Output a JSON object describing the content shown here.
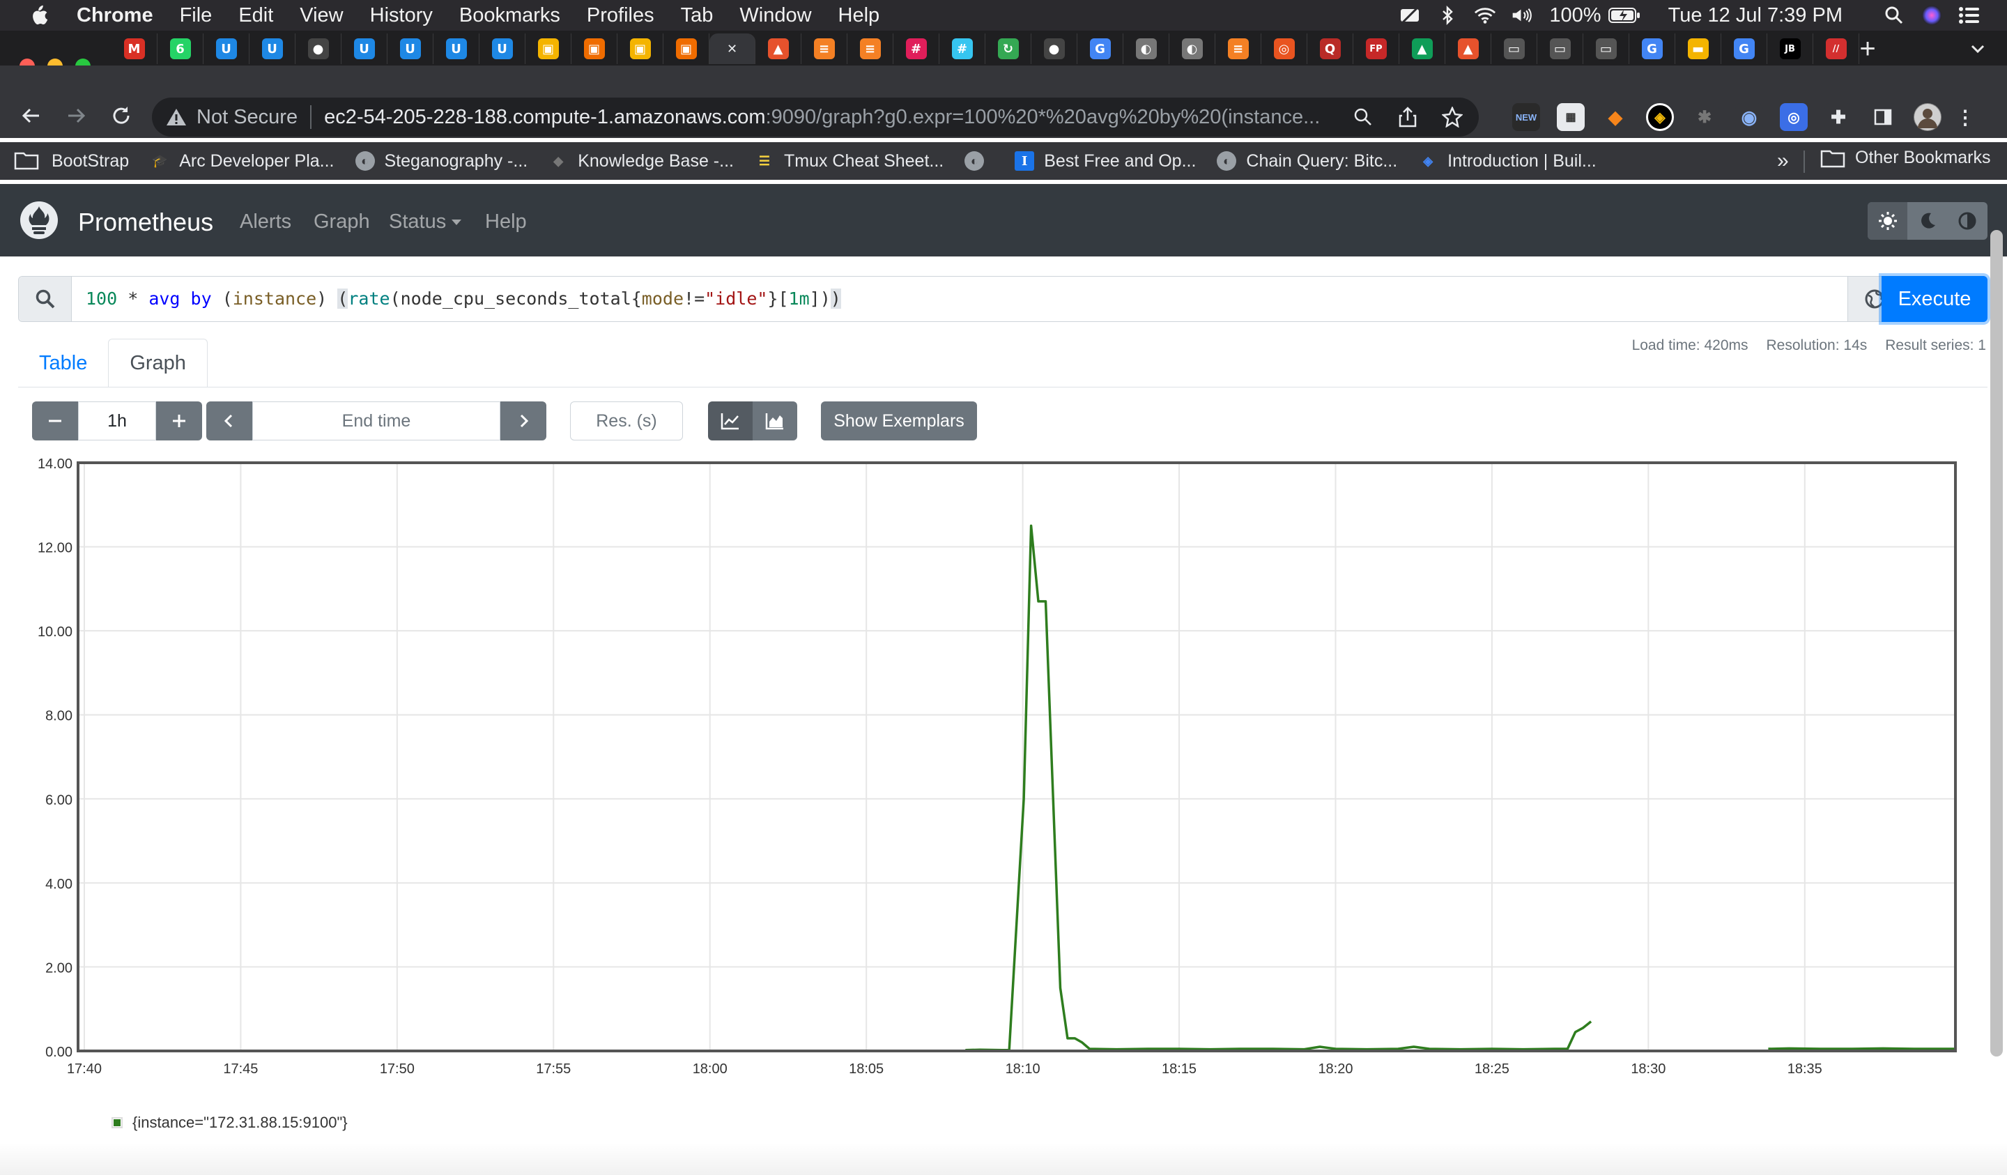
{
  "menubar": {
    "app": "Chrome",
    "items": [
      "File",
      "Edit",
      "View",
      "History",
      "Bookmarks",
      "Profiles",
      "Tab",
      "Window",
      "Help"
    ],
    "battery": "100%",
    "datetime": "Tue 12 Jul  7:39 PM"
  },
  "tabs": [
    {
      "icon": "gmail-icon",
      "glyph": "M",
      "color": "#d93025"
    },
    {
      "icon": "whatsapp-icon",
      "glyph": "6",
      "color": "#25d366"
    },
    {
      "icon": "udemy-icon",
      "glyph": "U",
      "color": "#1e88e5"
    },
    {
      "icon": "udemy-icon",
      "glyph": "U",
      "color": "#1e88e5"
    },
    {
      "icon": "github-icon",
      "glyph": "●",
      "color": "#444"
    },
    {
      "icon": "udemy-icon",
      "glyph": "U",
      "color": "#1e88e5"
    },
    {
      "icon": "udemy-icon",
      "glyph": "U",
      "color": "#1e88e5"
    },
    {
      "icon": "udemy-icon",
      "glyph": "U",
      "color": "#1e88e5"
    },
    {
      "icon": "udemy-icon",
      "glyph": "U",
      "color": "#1e88e5"
    },
    {
      "icon": "box-icon",
      "glyph": "▣",
      "color": "#f4b400"
    },
    {
      "icon": "aws-box-icon",
      "glyph": "▣",
      "color": "#ef6c00"
    },
    {
      "icon": "box-icon",
      "glyph": "▣",
      "color": "#f4b400"
    },
    {
      "icon": "aws-box-icon",
      "glyph": "▣",
      "color": "#ef6c00"
    },
    {
      "icon": "close-icon",
      "glyph": "✕",
      "color": "#35363a",
      "active": true
    },
    {
      "icon": "prometheus-icon",
      "glyph": "▲",
      "color": "#e6522c"
    },
    {
      "icon": "stackoverflow-icon",
      "glyph": "≡",
      "color": "#f48024"
    },
    {
      "icon": "stackoverflow-icon",
      "glyph": "≡",
      "color": "#f48024"
    },
    {
      "icon": "slack-icon",
      "glyph": "#",
      "color": "#e01e5a"
    },
    {
      "icon": "slack-icon",
      "glyph": "#",
      "color": "#36c5f0"
    },
    {
      "icon": "refresh-site-icon",
      "glyph": "↻",
      "color": "#34a853"
    },
    {
      "icon": "github-icon",
      "glyph": "●",
      "color": "#444"
    },
    {
      "icon": "google-icon",
      "glyph": "G",
      "color": "#4285f4"
    },
    {
      "icon": "globe-icon",
      "glyph": "◐",
      "color": "#777"
    },
    {
      "icon": "globe-icon",
      "glyph": "◐",
      "color": "#777"
    },
    {
      "icon": "stackoverflow-icon",
      "glyph": "≡",
      "color": "#f48024"
    },
    {
      "icon": "ubuntu-icon",
      "glyph": "◎",
      "color": "#e95420"
    },
    {
      "icon": "quora-icon",
      "glyph": "Q",
      "color": "#b92b27"
    },
    {
      "icon": "fp-icon",
      "glyph": "FP",
      "color": "#c62828"
    },
    {
      "icon": "drive-icon",
      "glyph": "▲",
      "color": "#0f9d58"
    },
    {
      "icon": "prometheus-icon",
      "glyph": "▲",
      "color": "#e6522c"
    },
    {
      "icon": "terminal-icon",
      "glyph": "▭",
      "color": "#555"
    },
    {
      "icon": "terminal-icon",
      "glyph": "▭",
      "color": "#555"
    },
    {
      "icon": "terminal-icon",
      "glyph": "▭",
      "color": "#555"
    },
    {
      "icon": "google-icon",
      "glyph": "G",
      "color": "#4285f4"
    },
    {
      "icon": "slides-icon",
      "glyph": "▬",
      "color": "#f4b400"
    },
    {
      "icon": "google-icon",
      "glyph": "G",
      "color": "#4285f4"
    },
    {
      "icon": "jetbrains-icon",
      "glyph": "JB",
      "color": "#000"
    },
    {
      "icon": "postman-icon",
      "glyph": "//",
      "color": "#d32f2f"
    }
  ],
  "omnibox": {
    "security": "Not Secure",
    "host": "ec2-54-205-228-188.compute-1.amazonaws.com",
    "rest": ":9090/graph?g0.expr=100%20*%20avg%20by%20(instance..."
  },
  "bookmarks": [
    {
      "label": "BootStrap",
      "icon": "folder-icon"
    },
    {
      "label": "Arc Developer Pla...",
      "icon": "graduation-cap-icon"
    },
    {
      "label": "Steganography -...",
      "icon": "globe-icon"
    },
    {
      "label": "Knowledge Base -...",
      "icon": "puzzle-icon"
    },
    {
      "label": "Tmux Cheat Sheet...",
      "icon": "list-icon"
    },
    {
      "label": "",
      "icon": "globe-icon"
    },
    {
      "label": "Best Free and Op...",
      "icon": "i-icon"
    },
    {
      "label": "Chain Query: Bitc...",
      "icon": "globe-icon"
    },
    {
      "label": "Introduction | Buil...",
      "icon": "layers-icon"
    }
  ],
  "bookmarks_more": "»",
  "bookmarks_other": "Other Bookmarks",
  "prom": {
    "brand": "Prometheus",
    "nav": [
      "Alerts",
      "Graph",
      "Status",
      "Help"
    ],
    "execute": "Execute",
    "tabs": [
      "Table",
      "Graph"
    ],
    "stats": {
      "load": "Load time: 420ms",
      "resolution": "Resolution: 14s",
      "series": "Result series: 1"
    },
    "range": "1h",
    "end_time_placeholder": "End time",
    "res_placeholder": "Res. (s)",
    "exemplars": "Show Exemplars",
    "query": {
      "num": "100",
      "star": " * ",
      "avg": "avg",
      "by": " by ",
      "open": "(",
      "label": "instance",
      "close": ") ",
      "bopen": "(",
      "fn": "rate",
      "p1": "(node_cpu_seconds_total{",
      "lbl2": "mode",
      "op": "!=",
      "str": "\"idle\"",
      "p2": "}[",
      "dur": "1m",
      "p3": "])",
      "bclose": ")"
    }
  },
  "chart_data": {
    "type": "line",
    "ylim": [
      0,
      14
    ],
    "yticks": [
      "0.00",
      "2.00",
      "4.00",
      "6.00",
      "8.00",
      "10.00",
      "12.00",
      "14.00"
    ],
    "xticks": [
      "17:40",
      "17:45",
      "17:50",
      "17:55",
      "18:00",
      "18:05",
      "18:10",
      "18:15",
      "18:20",
      "18:25",
      "18:30",
      "18:35"
    ],
    "xlim": [
      "17:39:48",
      "18:39:49"
    ],
    "color": "#2e7d1e",
    "series": [
      {
        "name": "{instance=\"172.31.88.15:9100\"}",
        "segments": [
          [
            [
              "18:08:10",
              0.02
            ],
            [
              "18:08:38",
              0.03
            ],
            [
              "18:09:20",
              0.02
            ],
            [
              "18:09:34",
              0.02
            ],
            [
              "18:10:02",
              6.0
            ],
            [
              "18:10:16",
              12.5
            ],
            [
              "18:10:30",
              10.7
            ],
            [
              "18:10:44",
              10.7
            ],
            [
              "18:11:12",
              1.5
            ],
            [
              "18:11:26",
              0.3
            ],
            [
              "18:11:40",
              0.3
            ],
            [
              "18:11:54",
              0.2
            ],
            [
              "18:12:08",
              0.05
            ],
            [
              "18:13:00",
              0.04
            ],
            [
              "18:14:00",
              0.05
            ],
            [
              "18:15:00",
              0.05
            ],
            [
              "18:16:00",
              0.04
            ],
            [
              "18:17:00",
              0.05
            ],
            [
              "18:18:00",
              0.05
            ],
            [
              "18:19:00",
              0.04
            ],
            [
              "18:19:30",
              0.1
            ],
            [
              "18:20:00",
              0.05
            ],
            [
              "18:21:00",
              0.04
            ],
            [
              "18:22:00",
              0.05
            ],
            [
              "18:22:30",
              0.1
            ],
            [
              "18:23:00",
              0.05
            ],
            [
              "18:24:00",
              0.04
            ],
            [
              "18:25:00",
              0.05
            ],
            [
              "18:26:00",
              0.04
            ],
            [
              "18:27:00",
              0.05
            ],
            [
              "18:27:25",
              0.05
            ],
            [
              "18:27:40",
              0.45
            ],
            [
              "18:27:55",
              0.55
            ],
            [
              "18:28:10",
              0.7
            ]
          ],
          [
            [
              "18:33:50",
              0.05
            ],
            [
              "18:34:30",
              0.06
            ],
            [
              "18:35:30",
              0.05
            ],
            [
              "18:36:30",
              0.05
            ],
            [
              "18:37:30",
              0.06
            ],
            [
              "18:38:30",
              0.05
            ],
            [
              "18:39:49",
              0.05
            ]
          ]
        ]
      }
    ]
  }
}
